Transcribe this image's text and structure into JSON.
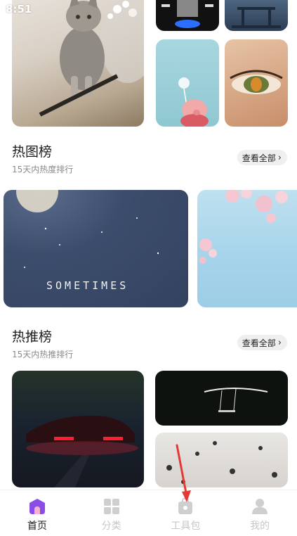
{
  "status_bar": {
    "time": "8:51"
  },
  "sections": [
    {
      "title": "热图榜",
      "subtitle": "15天内热度排行",
      "view_all": "查看全部"
    },
    {
      "title": "热推榜",
      "subtitle": "15天内热推排行",
      "view_all": "查看全部"
    }
  ],
  "wallpapers": {
    "sometimes_caption": "SOMETIMES"
  },
  "bottom_nav": {
    "items": [
      {
        "label": "首页",
        "icon": "home-icon",
        "active": true
      },
      {
        "label": "分类",
        "icon": "grid-icon",
        "active": false
      },
      {
        "label": "工具包",
        "icon": "toolbox-icon",
        "active": false
      },
      {
        "label": "我的",
        "icon": "profile-icon",
        "active": false
      }
    ]
  },
  "colors": {
    "accent": "#8a4de6",
    "annotation": "#e53935",
    "inactive_nav": "#c7c7c7"
  }
}
